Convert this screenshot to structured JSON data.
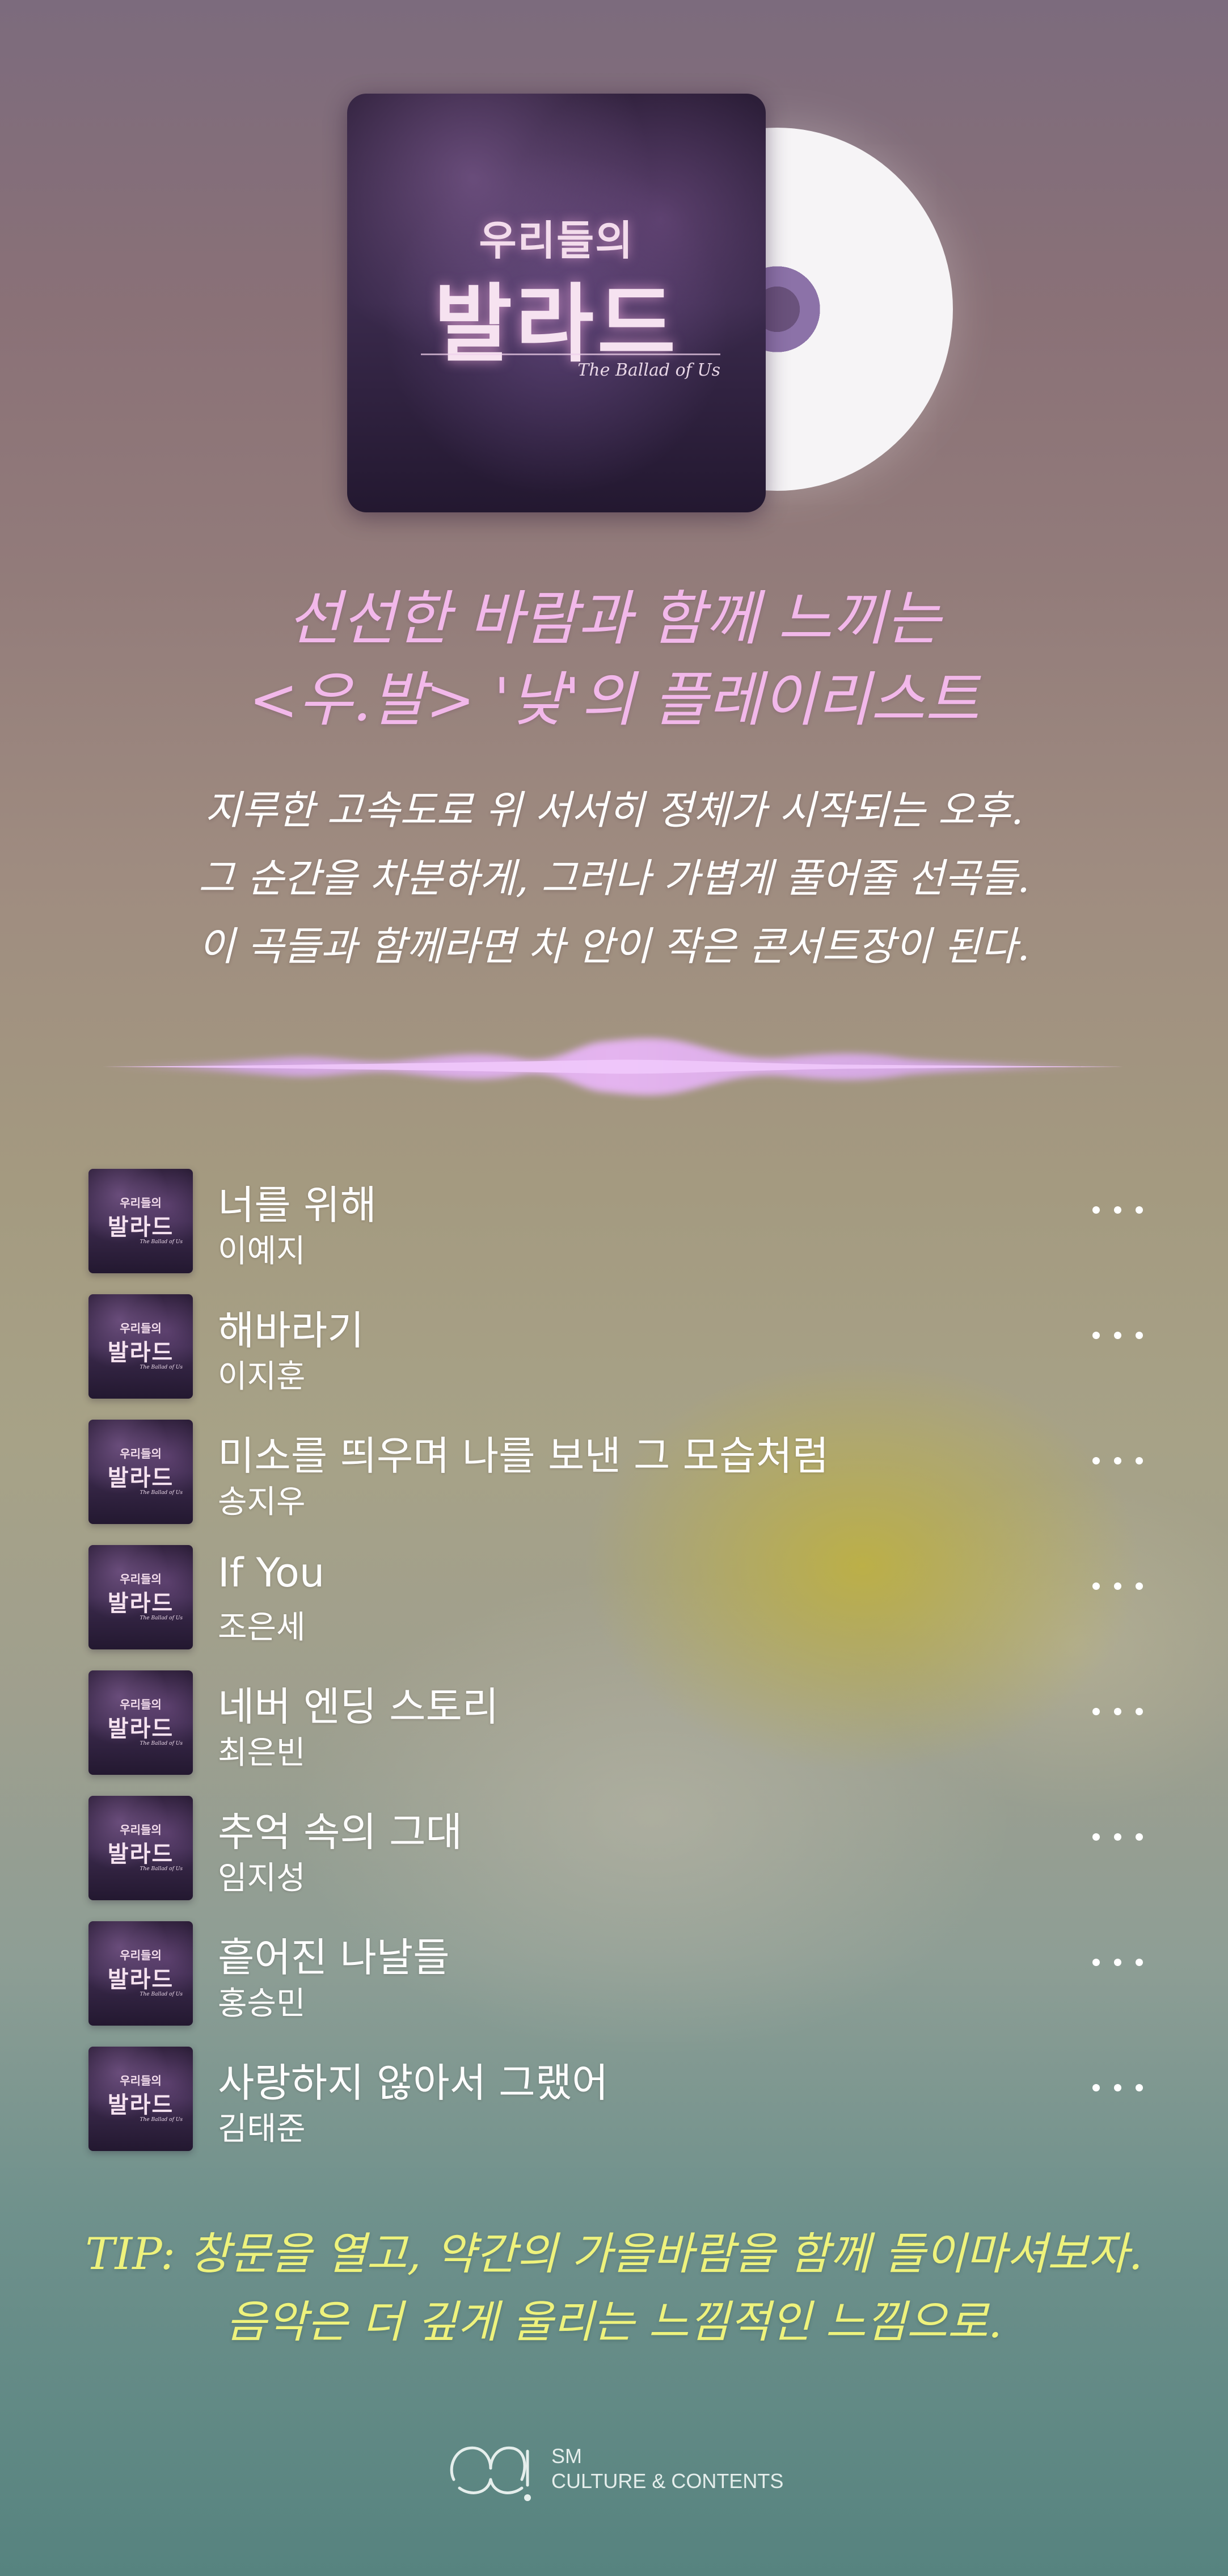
{
  "album": {
    "title_small": "우리들의",
    "title_large": "발라드",
    "subtitle": "The Ballad of Us"
  },
  "heading": {
    "line1": "선선한 바람과 함께 느끼는",
    "line2": "<우.발> '낮'의 플레이리스트"
  },
  "description": {
    "line1": "지루한 고속도로 위 서서히 정체가 시작되는 오후.",
    "line2": "그 순간을 차분하게, 그러나 가볍게 풀어줄 선곡들.",
    "line3": "이 곡들과 함께라면 차 안이 작은 콘서트장이 된다."
  },
  "tracks": [
    {
      "title": "너를 위해",
      "artist": "이예지"
    },
    {
      "title": "해바라기",
      "artist": "이지훈"
    },
    {
      "title": "미소를 띄우며 나를 보낸 그 모습처럼",
      "artist": "송지우"
    },
    {
      "title": "If You",
      "artist": "조은세"
    },
    {
      "title": "네버 엔딩 스토리",
      "artist": "최은빈"
    },
    {
      "title": "추억 속의 그대",
      "artist": "임지성"
    },
    {
      "title": "흩어진 나날들",
      "artist": "홍승민"
    },
    {
      "title": "사랑하지 않아서 그랬어",
      "artist": "김태준"
    }
  ],
  "tip": {
    "line1": "TIP: 창문을 열고, 약간의 가을바람을 함께 들이마셔보자.",
    "line2": "음악은 더 깊게 울리는 느낌적인 느낌으로."
  },
  "footer": {
    "brand_line1": "SM",
    "brand_line2": "CULTURE & CONTENTS"
  },
  "colors": {
    "heading": "#f2b8ea",
    "tip": "#eef27c",
    "wave": "#d9a9f0"
  },
  "icons": {
    "more": "more-horizontal-icon",
    "logo": "sm-logo-icon"
  }
}
